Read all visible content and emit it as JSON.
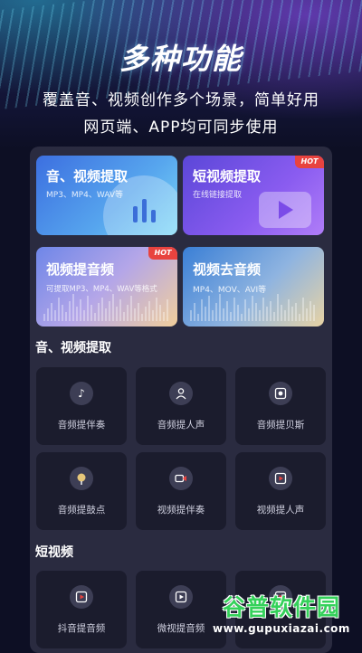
{
  "hero": {
    "title": "多种功能",
    "subtitle_line1": "覆盖音、视频创作多个场景，简单好用",
    "subtitle_line2": "网页端、APP均可同步使用"
  },
  "feature_cards": [
    {
      "title": "音、视频提取",
      "subtitle": "MP3、MP4、WAV等",
      "hot": ""
    },
    {
      "title": "短视频提取",
      "subtitle": "在线链接提取",
      "hot": "HOT"
    },
    {
      "title": "视频提音频",
      "subtitle": "可提取MP3、MP4、WAV等格式",
      "hot": "HOT"
    },
    {
      "title": "视频去音频",
      "subtitle": "MP4、MOV、AVI等",
      "hot": ""
    }
  ],
  "section1": {
    "title": "音、视频提取",
    "items": [
      {
        "label": "音频提伴奏",
        "icon": "music-note-icon"
      },
      {
        "label": "音频提人声",
        "icon": "person-icon"
      },
      {
        "label": "音频提贝斯",
        "icon": "speaker-icon"
      },
      {
        "label": "音频提鼓点",
        "icon": "drum-icon"
      },
      {
        "label": "视频提伴奏",
        "icon": "video-camera-icon"
      },
      {
        "label": "视频提人声",
        "icon": "play-icon"
      }
    ]
  },
  "section2": {
    "title": "短视频",
    "items": [
      {
        "label": "抖音提音频",
        "icon": "play-icon"
      },
      {
        "label": "微视提音频",
        "icon": "play-icon"
      },
      {
        "label": "",
        "icon": "play-icon"
      }
    ]
  },
  "watermark": {
    "line1": "谷普软件园",
    "line2": "www.gupuxiazai.com"
  },
  "colors": {
    "background": "#0d0f24",
    "panel": "#2a2b40",
    "tile": "#1b1c2d",
    "hot_badge": "#e8433f",
    "watermark_green": "#34d15a"
  }
}
